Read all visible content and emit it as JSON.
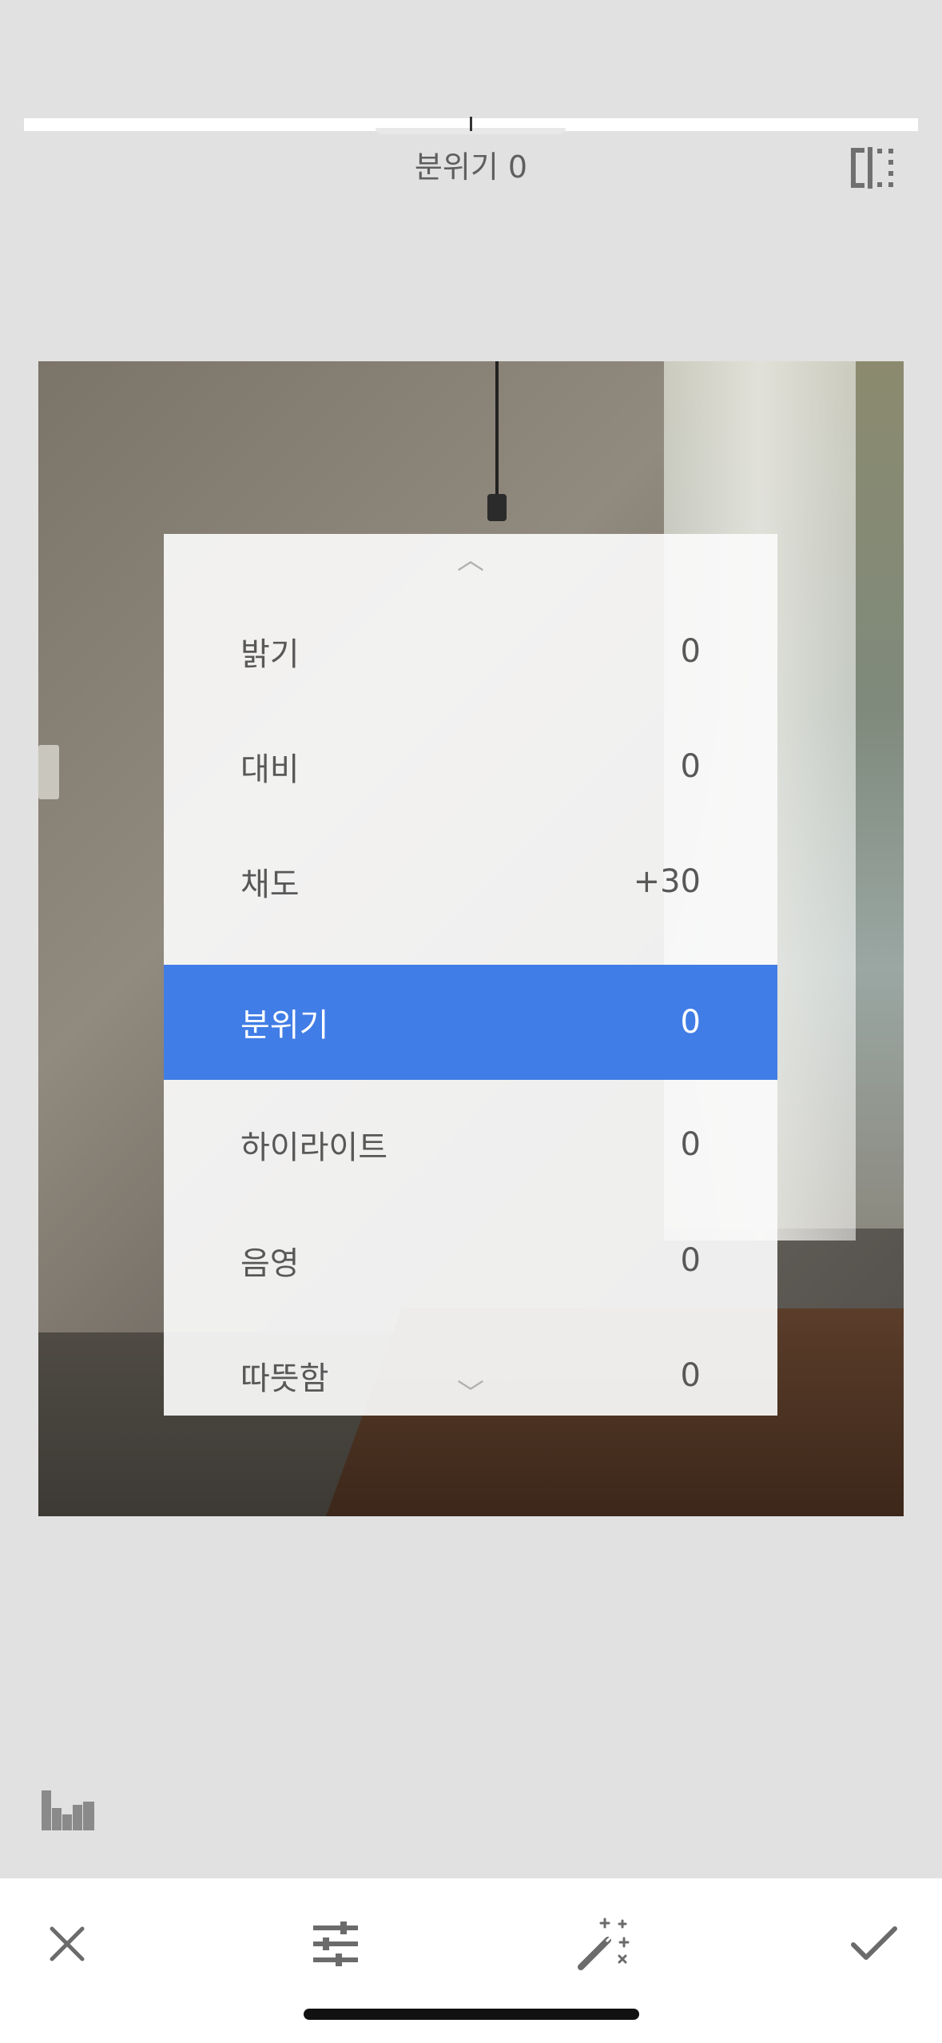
{
  "header": {
    "adjustment_label": "분위기 0",
    "slider_value": 0
  },
  "icons": {
    "compare": "compare-split-icon",
    "histogram": "histogram-icon",
    "close": "close-icon",
    "adjust": "sliders-icon",
    "auto": "magic-wand-icon",
    "apply": "checkmark-icon"
  },
  "menu": {
    "chevron_up": "︿",
    "chevron_down": "﹀",
    "items": [
      {
        "label": "밝기",
        "value": "0"
      },
      {
        "label": "대비",
        "value": "0"
      },
      {
        "label": "채도",
        "value": "+30"
      },
      {
        "label": "분위기",
        "value": "0",
        "selected": true
      },
      {
        "label": "하이라이트",
        "value": "0"
      },
      {
        "label": "음영",
        "value": "0"
      },
      {
        "label": "따뜻함",
        "value": "0"
      }
    ]
  },
  "colors": {
    "selected": "#417de6",
    "background": "#e1e1e1",
    "toolbar": "#ffffff"
  }
}
